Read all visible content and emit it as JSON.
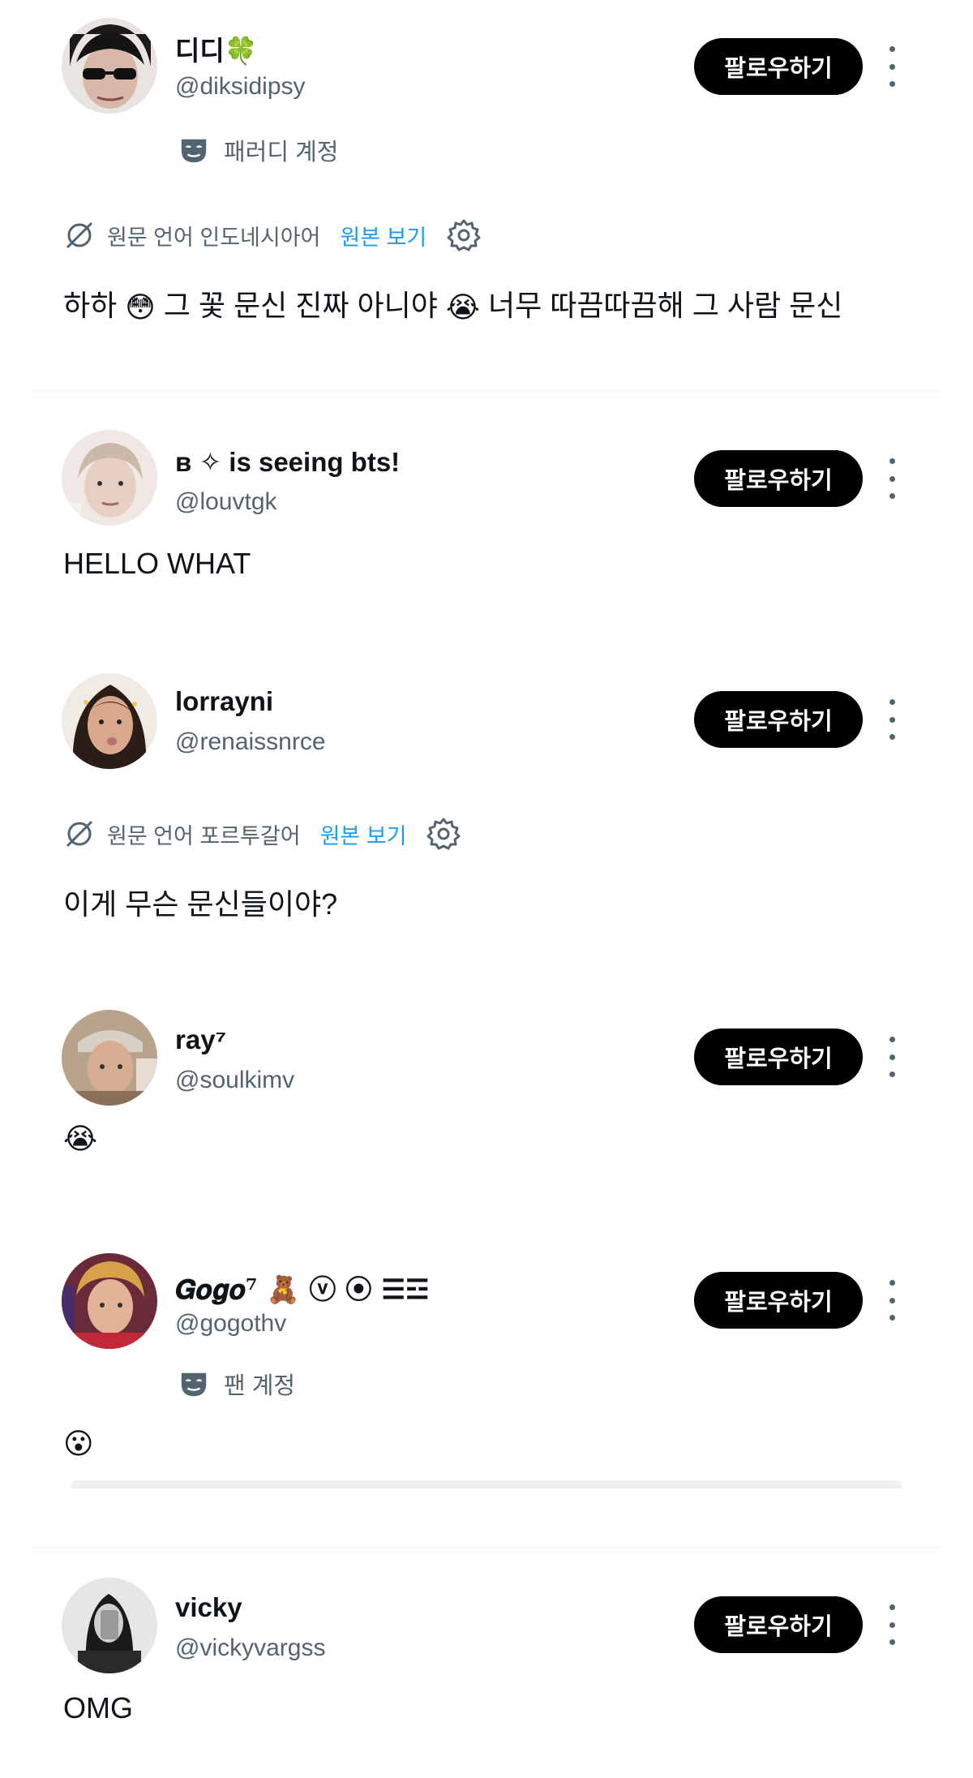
{
  "replies": [
    {
      "name": "디디🍀",
      "handle": "@diksidipsy",
      "follow_label": "팔로우하기",
      "badge": "패러디 계정",
      "translation": {
        "label": "원문 언어 인도네시아어",
        "show_original": "원본 보기"
      },
      "text_parts": [
        "하하 ",
        "😳",
        " 그 꽃 문신 진짜 아니야 ",
        "😭",
        " 너무 따끔따끔해 그 사람 문신"
      ]
    },
    {
      "name": "ʙ ✧ is seeing bts!",
      "handle": "@louvtgk",
      "follow_label": "팔로우하기",
      "text": "HELLO WHAT"
    },
    {
      "name": "lorrayni",
      "handle": "@renaissnrce",
      "follow_label": "팔로우하기",
      "translation": {
        "label": "원문 언어 포르투갈어",
        "show_original": "원본 보기"
      },
      "text": "이게 무슨 문신들이야?"
    },
    {
      "name": "ray⁷",
      "handle": "@soulkimv",
      "follow_label": "팔로우하기",
      "text": "😭"
    },
    {
      "name": "𝑮𝒐𝒈𝒐⁷ 🧸 ⓥ ⦿ ☰☲",
      "handle": "@gogothv",
      "follow_label": "팔로우하기",
      "badge": "팬 계정",
      "text": "😮"
    },
    {
      "name": "vicky",
      "handle": "@vickyvargss",
      "follow_label": "팔로우하기",
      "text": "OMG"
    }
  ],
  "colors": {
    "primary_text": "#0f1419",
    "secondary_text": "#536471",
    "link": "#1d9bf0",
    "button_bg": "#000000"
  },
  "icons": {
    "translate": "translate-icon",
    "settings": "gear-icon",
    "badge": "mask-icon",
    "more": "more-vertical-icon"
  }
}
